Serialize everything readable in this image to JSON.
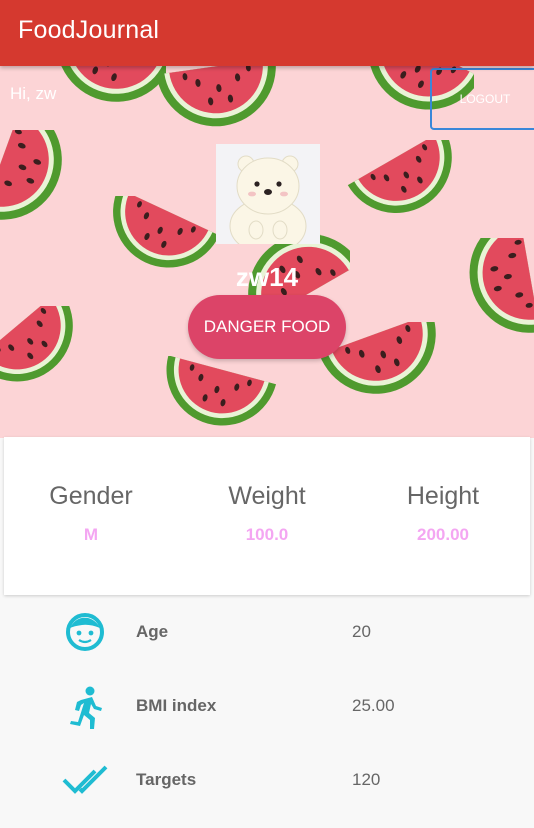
{
  "app": {
    "title": "FoodJournal"
  },
  "header": {
    "greeting": "Hi, zw",
    "logout_label": "LOGOUT"
  },
  "profile": {
    "username": "zw14",
    "danger_button_label": "DANGER FOOD"
  },
  "stats": [
    {
      "label": "Gender",
      "value": "M"
    },
    {
      "label": "Weight",
      "value": "100.0"
    },
    {
      "label": "Height",
      "value": "200.00"
    }
  ],
  "info": [
    {
      "icon": "face-icon",
      "label": "Age",
      "value": "20"
    },
    {
      "icon": "running-person-icon",
      "label": "BMI index",
      "value": "25.00"
    },
    {
      "icon": "double-check-icon",
      "label": "Targets",
      "value": "120"
    }
  ],
  "colors": {
    "appbar": "#d5392f",
    "accent_icon": "#1fbcd2",
    "stat_value": "#f4a6f2",
    "danger_button": "#dc4468",
    "hero_background": "#fcd4d6"
  }
}
